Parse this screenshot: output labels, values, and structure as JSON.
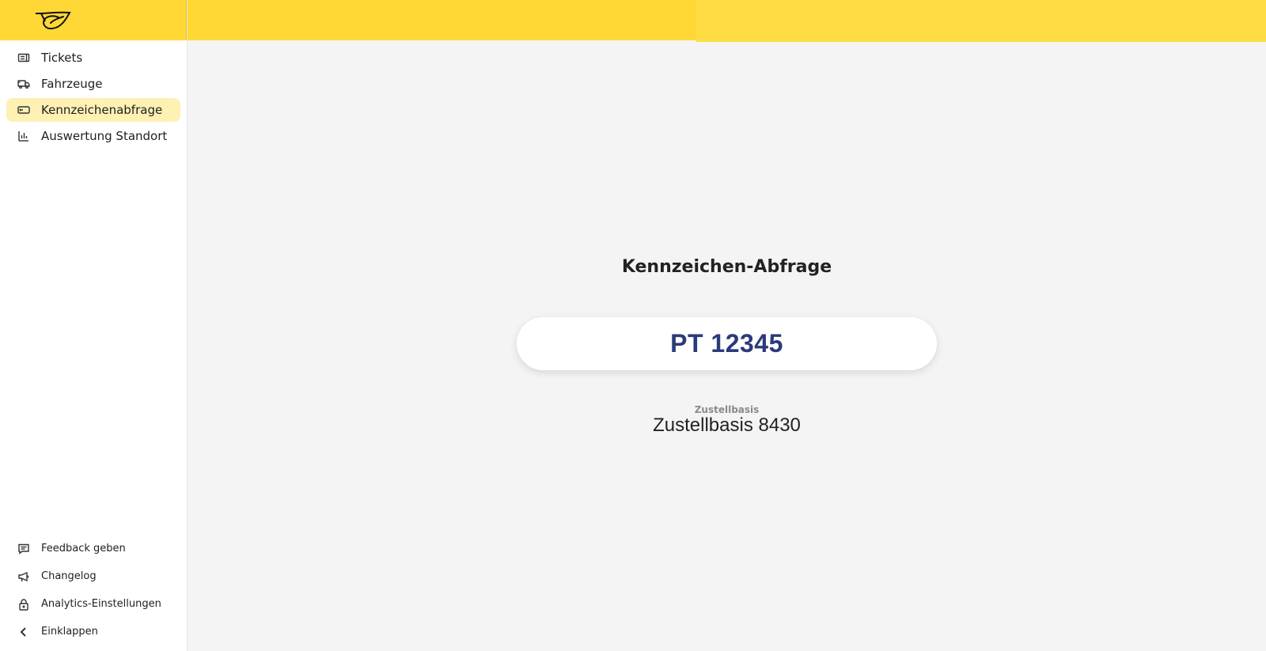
{
  "nav": {
    "items": [
      {
        "label": "Tickets",
        "icon": "ticket-icon"
      },
      {
        "label": "Fahrzeuge",
        "icon": "truck-icon"
      },
      {
        "label": "Kennzeichenabfrage",
        "icon": "license-plate-icon",
        "active": true
      },
      {
        "label": "Auswertung Standort",
        "icon": "bar-chart-icon"
      }
    ]
  },
  "bottom_nav": {
    "items": [
      {
        "label": "Feedback geben",
        "icon": "feedback-icon"
      },
      {
        "label": "Changelog",
        "icon": "megaphone-icon"
      },
      {
        "label": "Analytics-Einstellungen",
        "icon": "lock-icon"
      },
      {
        "label": "Einklappen",
        "icon": "chevron-left-icon"
      }
    ]
  },
  "main": {
    "title": "Kennzeichen-Abfrage",
    "plate": "PT 12345",
    "info_label": "Zustellbasis",
    "info_value": "Zustellbasis 8430"
  },
  "colors": {
    "header": "#ffd835",
    "active_nav": "#fff0b3",
    "plate_text": "#2b3a7a",
    "background": "#f4f4f4"
  }
}
